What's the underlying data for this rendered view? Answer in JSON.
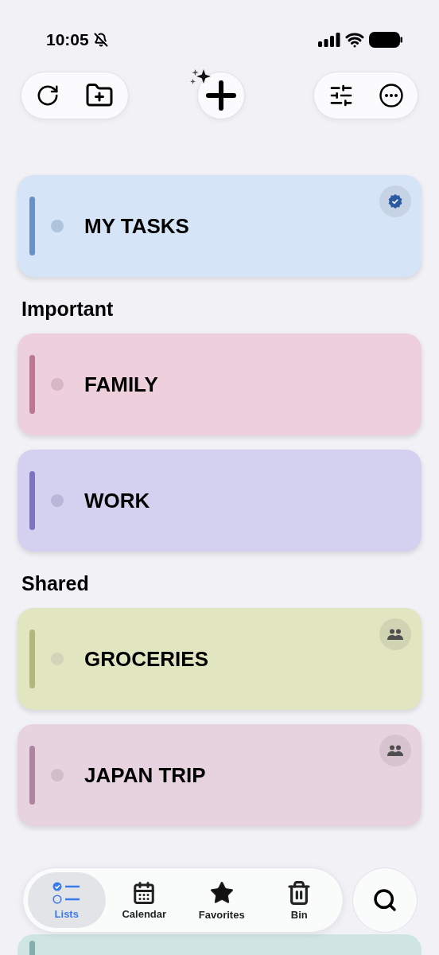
{
  "status_bar": {
    "time": "10:05",
    "silent": true
  },
  "sections": [
    {
      "lists": [
        {
          "title": "MY TASKS",
          "color": "#d6e4f7",
          "kind": "verified"
        }
      ]
    },
    {
      "heading": "Important",
      "lists": [
        {
          "title": "FAMILY",
          "color": "#eed0dc",
          "kind": "plain"
        },
        {
          "title": "WORK",
          "color": "#d4d1f0",
          "kind": "plain"
        }
      ]
    },
    {
      "heading": "Shared",
      "lists": [
        {
          "title": "GROCERIES",
          "color": "#e1e5c0",
          "kind": "shared"
        },
        {
          "title": "JAPAN TRIP",
          "color": "#e7d2df",
          "kind": "shared"
        }
      ]
    },
    {
      "lists": [
        {
          "color": "#cfe5e3",
          "kind": "peek"
        }
      ]
    }
  ],
  "tab_bar": [
    {
      "label": "Lists",
      "selected": true
    },
    {
      "label": "Calendar",
      "selected": false
    },
    {
      "label": "Favorites",
      "selected": false
    },
    {
      "label": "Bin",
      "selected": false
    }
  ]
}
